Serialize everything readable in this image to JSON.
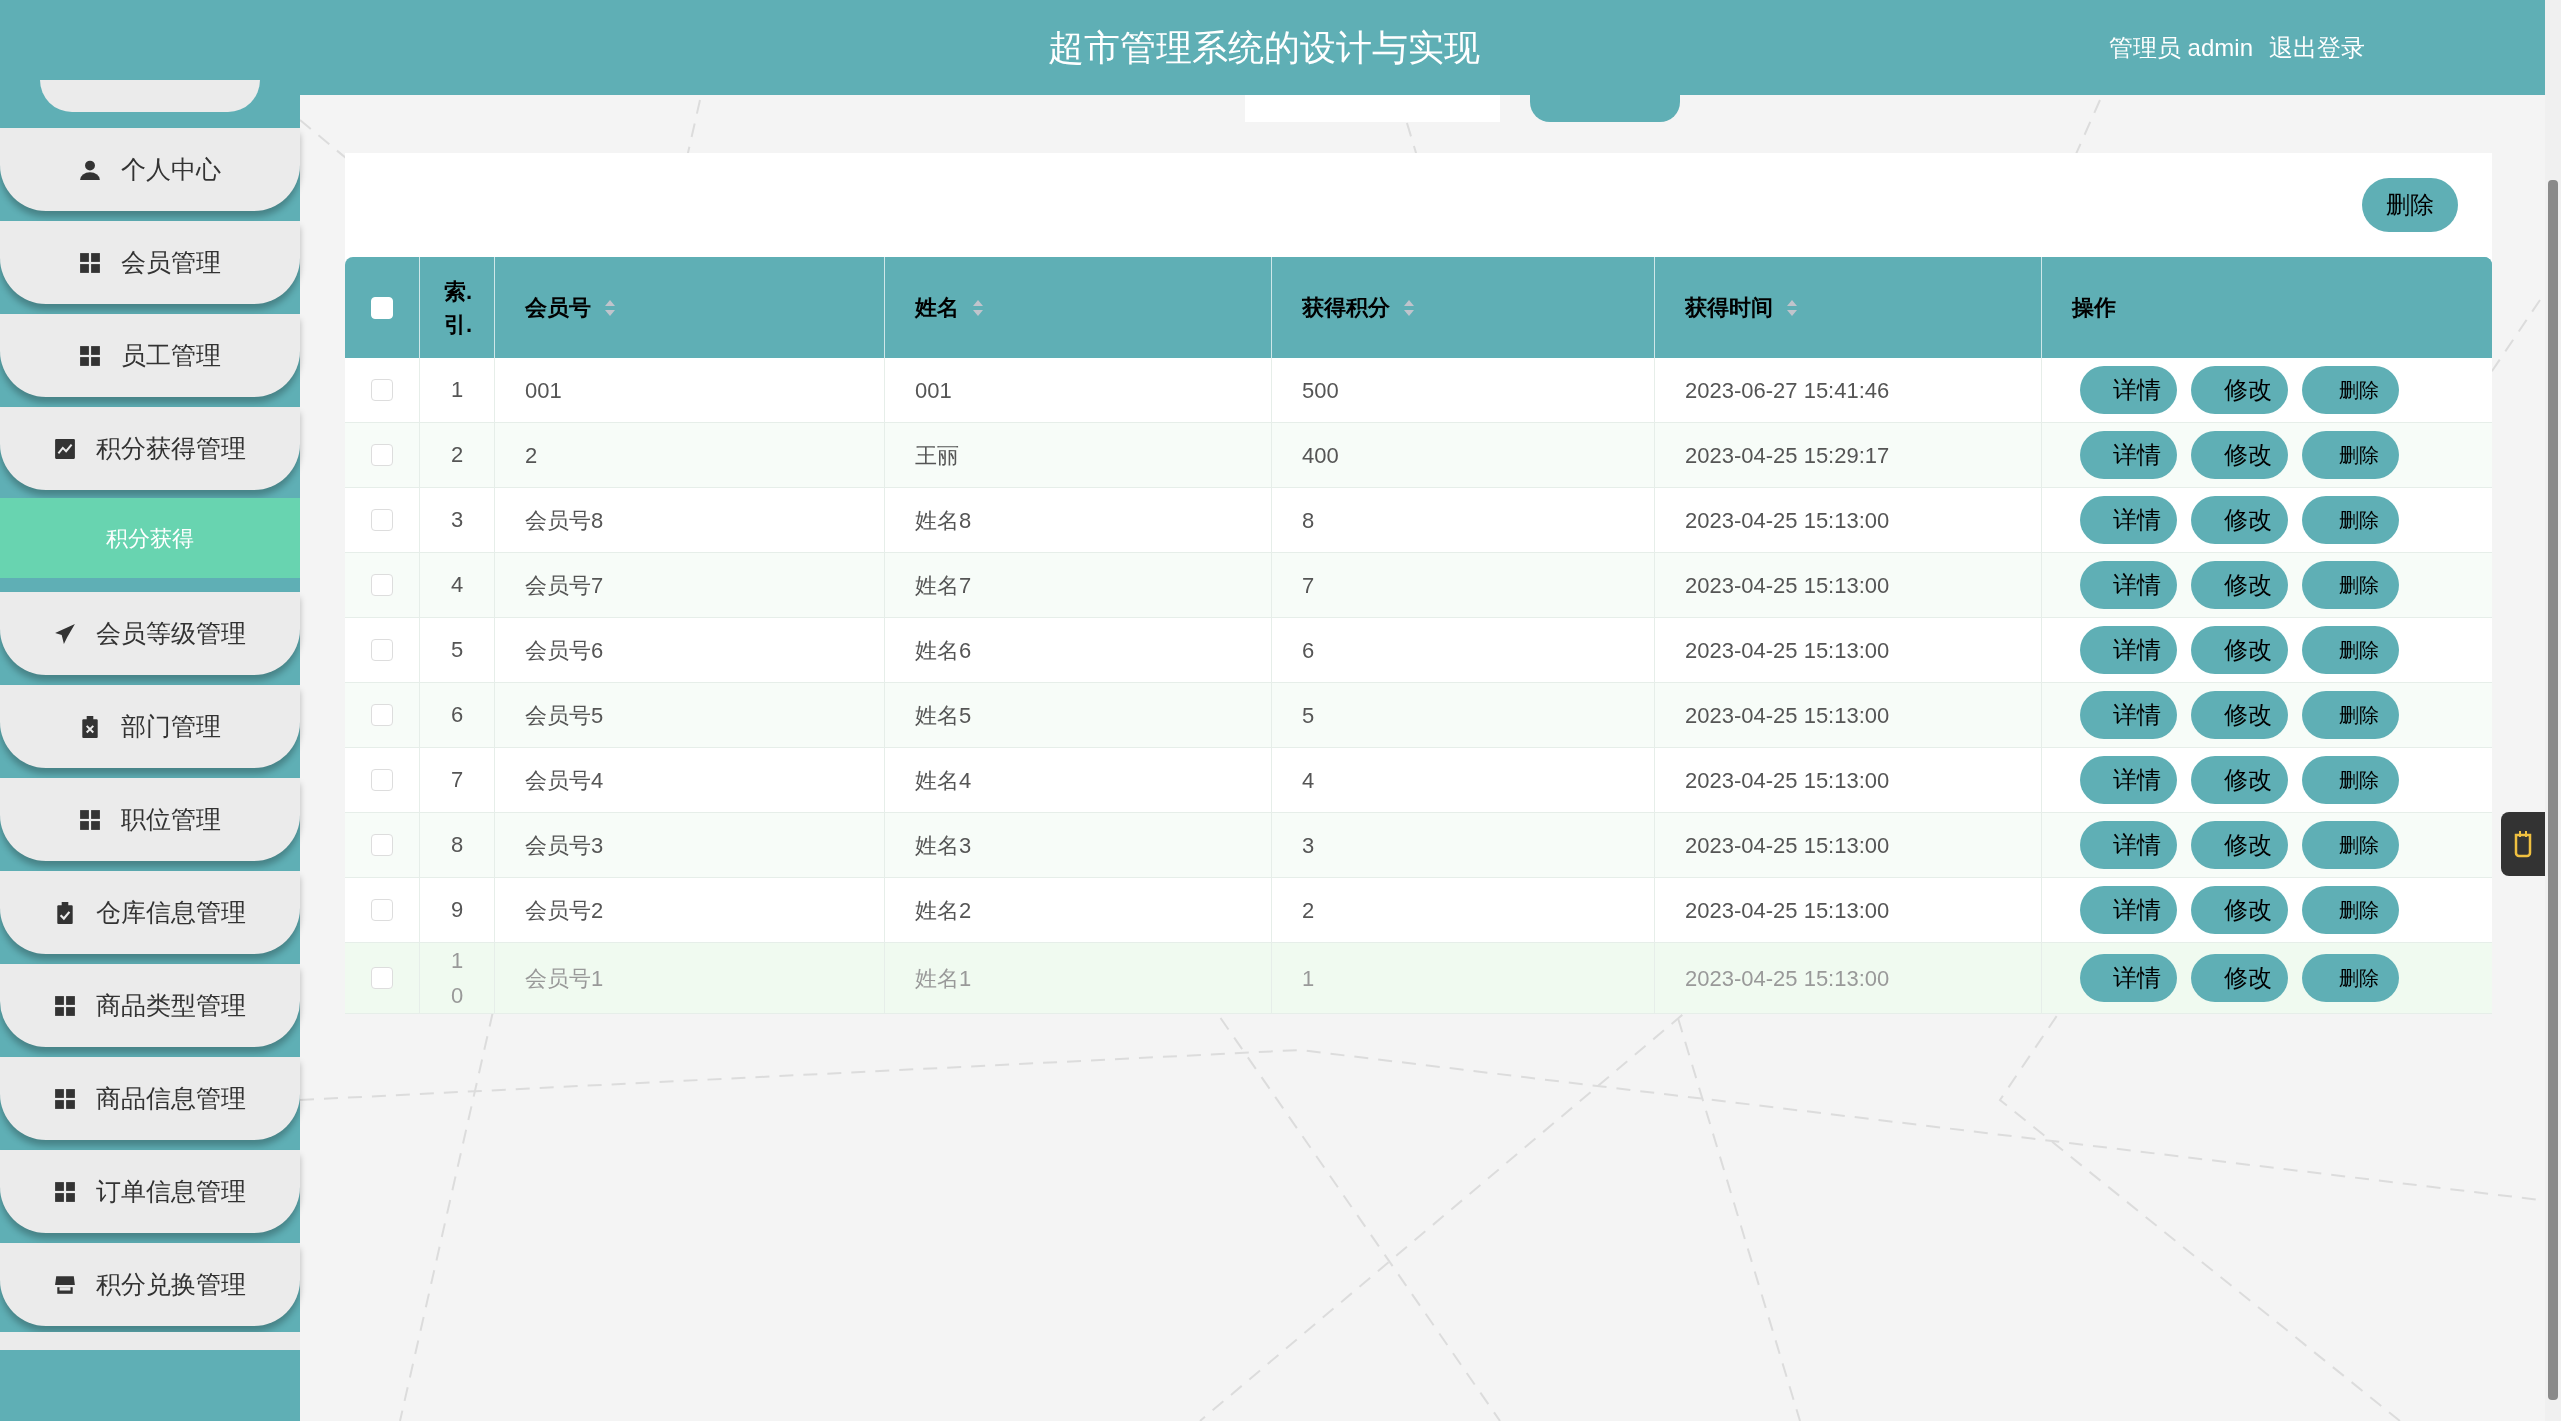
{
  "header": {
    "title": "超市管理系统的设计与实现",
    "user": "管理员 admin",
    "logout": "退出登录"
  },
  "sidebar": {
    "items": [
      {
        "label": "个人中心",
        "kind": "user",
        "selected": false
      },
      {
        "label": "会员管理",
        "kind": "grid",
        "selected": false
      },
      {
        "label": "员工管理",
        "kind": "grid",
        "selected": false
      },
      {
        "label": "积分获得管理",
        "kind": "chart",
        "selected": false,
        "children": [
          {
            "label": "积分获得",
            "selected": true
          }
        ]
      },
      {
        "label": "会员等级管理",
        "kind": "plane",
        "selected": false
      },
      {
        "label": "部门管理",
        "kind": "clipboard-x",
        "selected": false
      },
      {
        "label": "职位管理",
        "kind": "grid",
        "selected": false
      },
      {
        "label": "仓库信息管理",
        "kind": "clipboard-check",
        "selected": false
      },
      {
        "label": "商品类型管理",
        "kind": "grid",
        "selected": false
      },
      {
        "label": "商品信息管理",
        "kind": "grid",
        "selected": false
      },
      {
        "label": "订单信息管理",
        "kind": "grid",
        "selected": false
      },
      {
        "label": "积分兑换管理",
        "kind": "store",
        "selected": false
      }
    ]
  },
  "toolbar": {
    "delete_button": "删除"
  },
  "table": {
    "select_all": {
      "checked": false
    },
    "columns": [
      {
        "label": "索.引.",
        "sortable": false
      },
      {
        "label": "会员号",
        "sortable": true
      },
      {
        "label": "姓名",
        "sortable": true
      },
      {
        "label": "获得积分",
        "sortable": true
      },
      {
        "label": "获得时间",
        "sortable": true
      },
      {
        "label": "操作",
        "sortable": false
      }
    ],
    "rows": [
      {
        "checked": false,
        "highlighted": false,
        "index": "1",
        "member_id": "001",
        "name": "001",
        "points": "500",
        "time": "2023-06-27 15:41:46",
        "actions": [
          "详情",
          "修改",
          "删除"
        ]
      },
      {
        "checked": false,
        "highlighted": false,
        "index": "2",
        "member_id": "2",
        "name": "王丽",
        "points": "400",
        "time": "2023-04-25 15:29:17",
        "actions": [
          "详情",
          "修改",
          "删除"
        ]
      },
      {
        "checked": false,
        "highlighted": false,
        "index": "3",
        "member_id": "会员号8",
        "name": "姓名8",
        "points": "8",
        "time": "2023-04-25 15:13:00",
        "actions": [
          "详情",
          "修改",
          "删除"
        ]
      },
      {
        "checked": false,
        "highlighted": false,
        "index": "4",
        "member_id": "会员号7",
        "name": "姓名7",
        "points": "7",
        "time": "2023-04-25 15:13:00",
        "actions": [
          "详情",
          "修改",
          "删除"
        ]
      },
      {
        "checked": false,
        "highlighted": false,
        "index": "5",
        "member_id": "会员号6",
        "name": "姓名6",
        "points": "6",
        "time": "2023-04-25 15:13:00",
        "actions": [
          "详情",
          "修改",
          "删除"
        ]
      },
      {
        "checked": false,
        "highlighted": false,
        "index": "6",
        "member_id": "会员号5",
        "name": "姓名5",
        "points": "5",
        "time": "2023-04-25 15:13:00",
        "actions": [
          "详情",
          "修改",
          "删除"
        ]
      },
      {
        "checked": false,
        "highlighted": false,
        "index": "7",
        "member_id": "会员号4",
        "name": "姓名4",
        "points": "4",
        "time": "2023-04-25 15:13:00",
        "actions": [
          "详情",
          "修改",
          "删除"
        ]
      },
      {
        "checked": false,
        "highlighted": false,
        "index": "8",
        "member_id": "会员号3",
        "name": "姓名3",
        "points": "3",
        "time": "2023-04-25 15:13:00",
        "actions": [
          "详情",
          "修改",
          "删除"
        ]
      },
      {
        "checked": false,
        "highlighted": false,
        "index": "9",
        "member_id": "会员号2",
        "name": "姓名2",
        "points": "2",
        "time": "2023-04-25 15:13:00",
        "actions": [
          "详情",
          "修改",
          "删除"
        ]
      },
      {
        "checked": false,
        "highlighted": true,
        "index": "10",
        "member_id": "会员号1",
        "name": "姓名1",
        "points": "1",
        "time": "2023-04-25 15:13:00",
        "actions": [
          "详情",
          "修改",
          "删除"
        ]
      }
    ]
  }
}
